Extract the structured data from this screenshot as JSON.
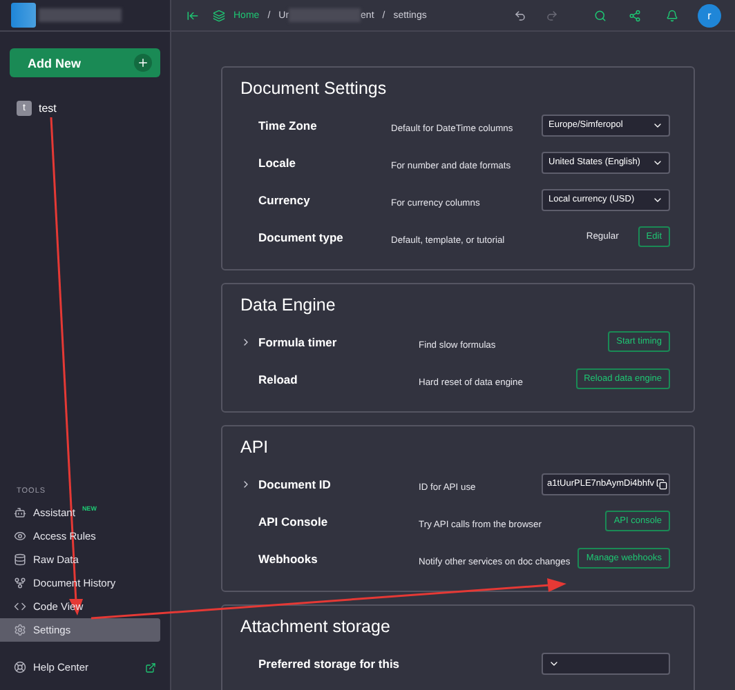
{
  "topbar": {
    "home": "Home",
    "doc_start": "Ur",
    "doc_end": "ent",
    "separator_1": "/",
    "separator_2": "/",
    "page": "settings",
    "avatar": "r"
  },
  "sidebar": {
    "add_button": "Add New",
    "pages": [
      {
        "initial": "t",
        "name": "test",
        "selected": false
      }
    ],
    "tools_heading": "TOOLS",
    "tools": [
      {
        "label": "Assistant",
        "badge": "NEW",
        "selected": false
      },
      {
        "label": "Access Rules",
        "selected": false
      },
      {
        "label": "Raw Data",
        "selected": false
      },
      {
        "label": "Document History",
        "selected": false
      },
      {
        "label": "Code View",
        "selected": false
      },
      {
        "label": "Settings",
        "selected": true
      }
    ],
    "help": "Help Center"
  },
  "sections": [
    {
      "title": "Document Settings",
      "rows": [
        {
          "label": "Time Zone",
          "description": "Default for DateTime columns",
          "expandable": false,
          "controls": [
            {
              "kind": "select",
              "value": "Europe/Simferopol"
            }
          ]
        },
        {
          "label": "Locale",
          "description": "For number and date formats",
          "expandable": false,
          "controls": [
            {
              "kind": "select",
              "value": "United States (English)"
            }
          ]
        },
        {
          "label": "Currency",
          "description": "For currency columns",
          "expandable": false,
          "controls": [
            {
              "kind": "select",
              "value": "Local currency (USD)"
            }
          ]
        },
        {
          "label": "Document type",
          "description": "Default, template, or tutorial",
          "expandable": false,
          "controls": [
            {
              "kind": "text",
              "value": "Regular"
            },
            {
              "kind": "button",
              "value": "Edit"
            }
          ]
        }
      ]
    },
    {
      "title": "Data Engine",
      "rows": [
        {
          "label": "Formula timer",
          "description": "Find slow formulas",
          "expandable": true,
          "controls": [
            {
              "kind": "button",
              "value": "Start timing"
            }
          ]
        },
        {
          "label": "Reload",
          "description": "Hard reset of data engine",
          "expandable": false,
          "controls": [
            {
              "kind": "button",
              "value": "Reload data engine"
            }
          ]
        }
      ]
    },
    {
      "title": "API",
      "rows": [
        {
          "label": "Document ID",
          "description": "ID for API use",
          "expandable": true,
          "controls": [
            {
              "kind": "field",
              "value": "a1tUurPLE7nbAymDi4bhfv"
            }
          ]
        },
        {
          "label": "API Console",
          "description": "Try API calls from the browser",
          "expandable": false,
          "controls": [
            {
              "kind": "button",
              "value": "API console"
            }
          ]
        },
        {
          "label": "Webhooks",
          "description": "Notify other services on doc changes",
          "expandable": false,
          "controls": [
            {
              "kind": "button",
              "value": "Manage webhooks"
            }
          ]
        }
      ]
    },
    {
      "title": "Attachment storage",
      "rows": [
        {
          "label": "Preferred storage for this",
          "expandable": false,
          "controls": [
            {
              "kind": "select"
            }
          ]
        }
      ]
    }
  ]
}
